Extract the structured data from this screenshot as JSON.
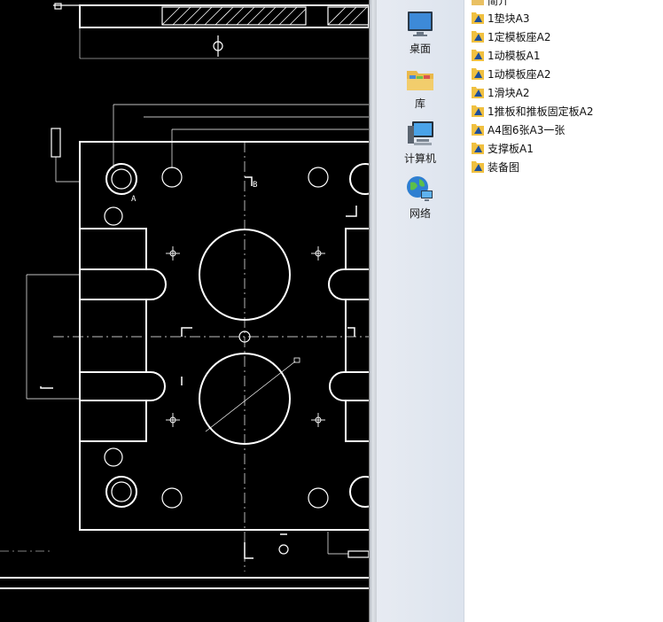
{
  "nav": {
    "items": [
      {
        "label": "桌面",
        "icon": "desktop-icon"
      },
      {
        "label": "库",
        "icon": "library-icon"
      },
      {
        "label": "计算机",
        "icon": "computer-icon"
      },
      {
        "label": "网络",
        "icon": "network-icon"
      }
    ]
  },
  "files": {
    "items": [
      {
        "label": "简介",
        "icon": "folder-icon"
      },
      {
        "label": "1垫块A3",
        "icon": "cad-file-icon"
      },
      {
        "label": "1定模板座A2",
        "icon": "cad-file-icon"
      },
      {
        "label": "1动模板A1",
        "icon": "cad-file-icon"
      },
      {
        "label": "1动模板座A2",
        "icon": "cad-file-icon"
      },
      {
        "label": "1滑块A2",
        "icon": "cad-file-icon"
      },
      {
        "label": "1推板和推板固定板A2",
        "icon": "cad-file-icon"
      },
      {
        "label": "A4图6张A3一张",
        "icon": "cad-file-icon"
      },
      {
        "label": "支撑板A1",
        "icon": "cad-file-icon"
      },
      {
        "label": "装备图",
        "icon": "cad-file-icon"
      }
    ]
  },
  "cad": {
    "section_label_a": "A",
    "section_label_b": "B"
  }
}
